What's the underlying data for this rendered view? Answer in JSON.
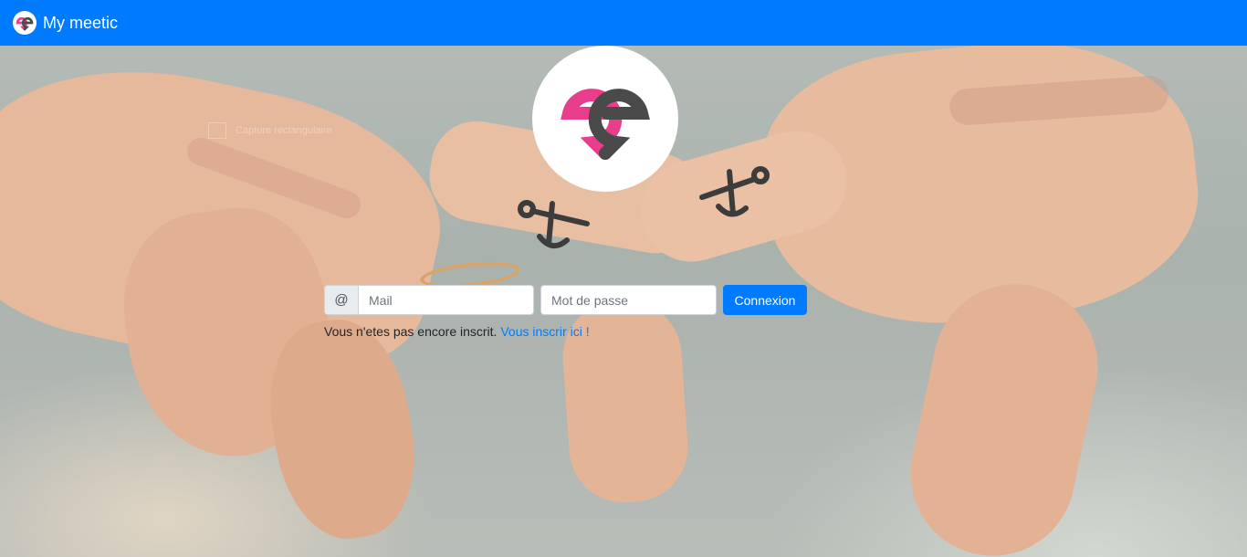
{
  "navbar": {
    "brand_text": "My meetic",
    "logo_icon": "meetic-heart-logo",
    "background_color": "#007bff"
  },
  "hero": {
    "background_description_icon": "linked-hands-anchor-tattoo-photo",
    "ghost_caption": "Capture rectangulaire"
  },
  "login": {
    "email_addon": "@",
    "email_placeholder": "Mail",
    "password_placeholder": "Mot de passe",
    "submit_label": "Connexion"
  },
  "register": {
    "prompt": "Vous n'etes pas encore inscrit.",
    "link_label": "Vous inscrir ici !"
  },
  "colors": {
    "accent": "#007bff",
    "logo_pink": "#e83e8c",
    "logo_gray": "#4a4a4a"
  }
}
